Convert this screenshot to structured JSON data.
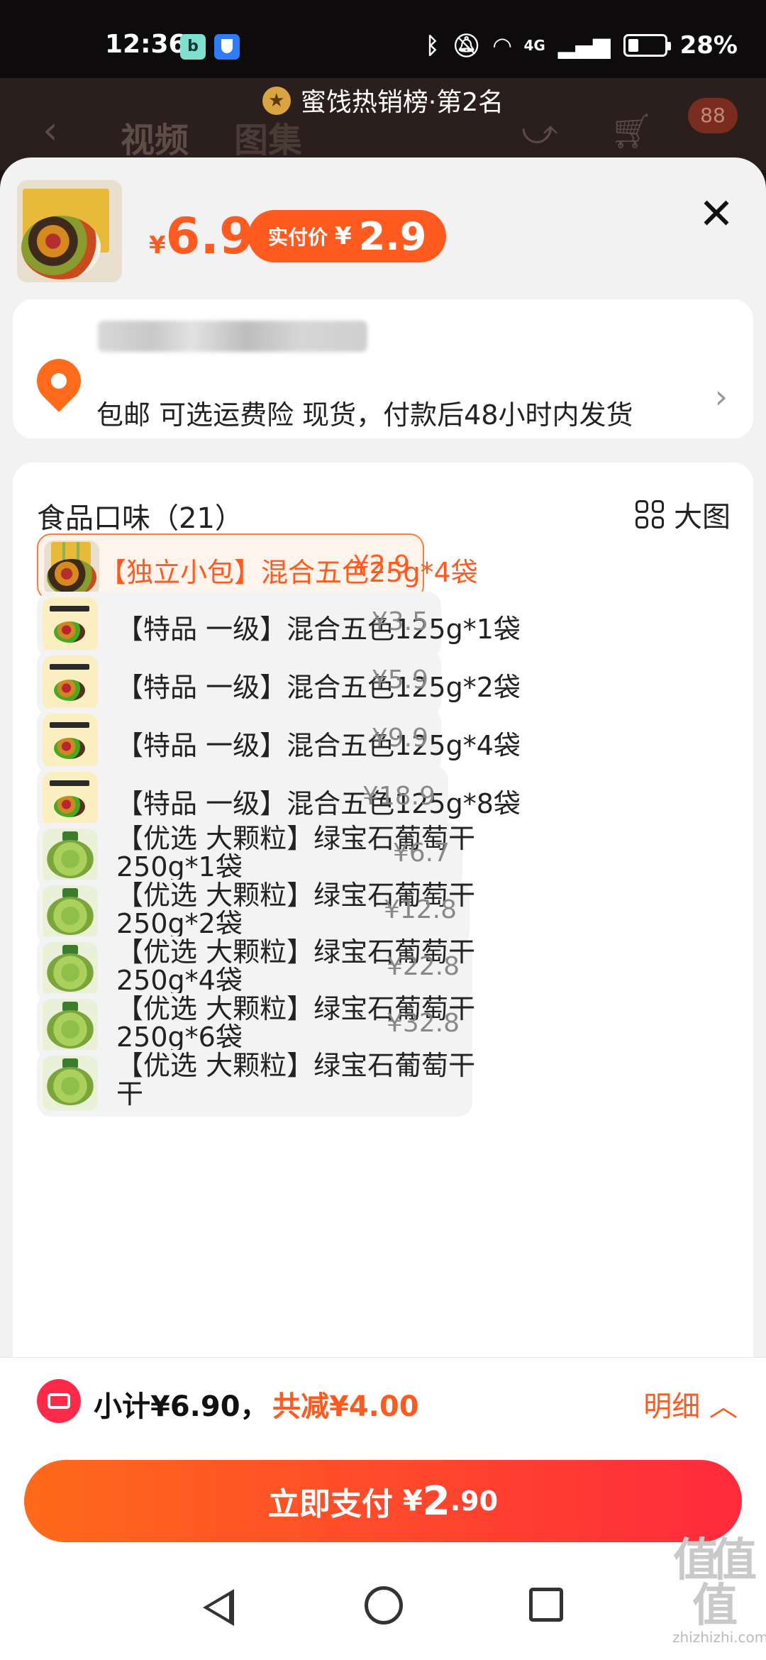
{
  "status_bar": {
    "time": "12:36",
    "app1_letter": "b",
    "signal_label": "4G",
    "battery": "28%"
  },
  "background_page": {
    "rank_banner": "蜜饯热销榜·第2名",
    "tabs": [
      "视频",
      "图集"
    ],
    "cart_badge": "88"
  },
  "sheet": {
    "price": {
      "currency": "¥",
      "value": "6.9"
    },
    "pay_pill": {
      "label": "实付价",
      "currency": "¥",
      "value": "2.9"
    },
    "shipping": "包邮 可选运费险 现货，付款后48小时内发货",
    "options_title": "食品口味（21）",
    "big_view_label": "大图",
    "options": [
      {
        "label": "【独立小包】混合五色25g*4袋",
        "price": "¥2.9",
        "selected": true
      },
      {
        "label": "【特品 一级】混合五色125g*1袋",
        "price": "¥3.5"
      },
      {
        "label": "【特品 一级】混合五色125g*2袋",
        "price": "¥5.9"
      },
      {
        "label": "【特品 一级】混合五色125g*4袋",
        "price": "¥9.9"
      },
      {
        "label": "【特品 一级】混合五色125g*8袋",
        "price": "¥18.9"
      },
      {
        "label": "【优选 大颗粒】绿宝石葡萄干250g*1袋",
        "price": "¥6.7"
      },
      {
        "label": "【优选 大颗粒】绿宝石葡萄干250g*2袋",
        "price": "¥12.8"
      },
      {
        "label": "【优选 大颗粒】绿宝石葡萄干250g*4袋",
        "price": "¥22.8"
      },
      {
        "label": "【优选 大颗粒】绿宝石葡萄干250g*6袋",
        "price": "¥32.8"
      },
      {
        "label": "【优选 大颗粒】绿宝石葡萄干干",
        "price": ""
      }
    ]
  },
  "bottom": {
    "subtotal": "小计¥6.90，",
    "discount": "共减¥4.00",
    "detail": "明细",
    "pay_button": {
      "label": "立即支付",
      "currency": "¥",
      "amount": "2",
      "decimal": ".90"
    }
  },
  "watermark": {
    "site": "zhizhizhi.com"
  },
  "colors": {
    "accent": "#ff5a1f",
    "pay_gradient_end": "#ff2a3c"
  }
}
